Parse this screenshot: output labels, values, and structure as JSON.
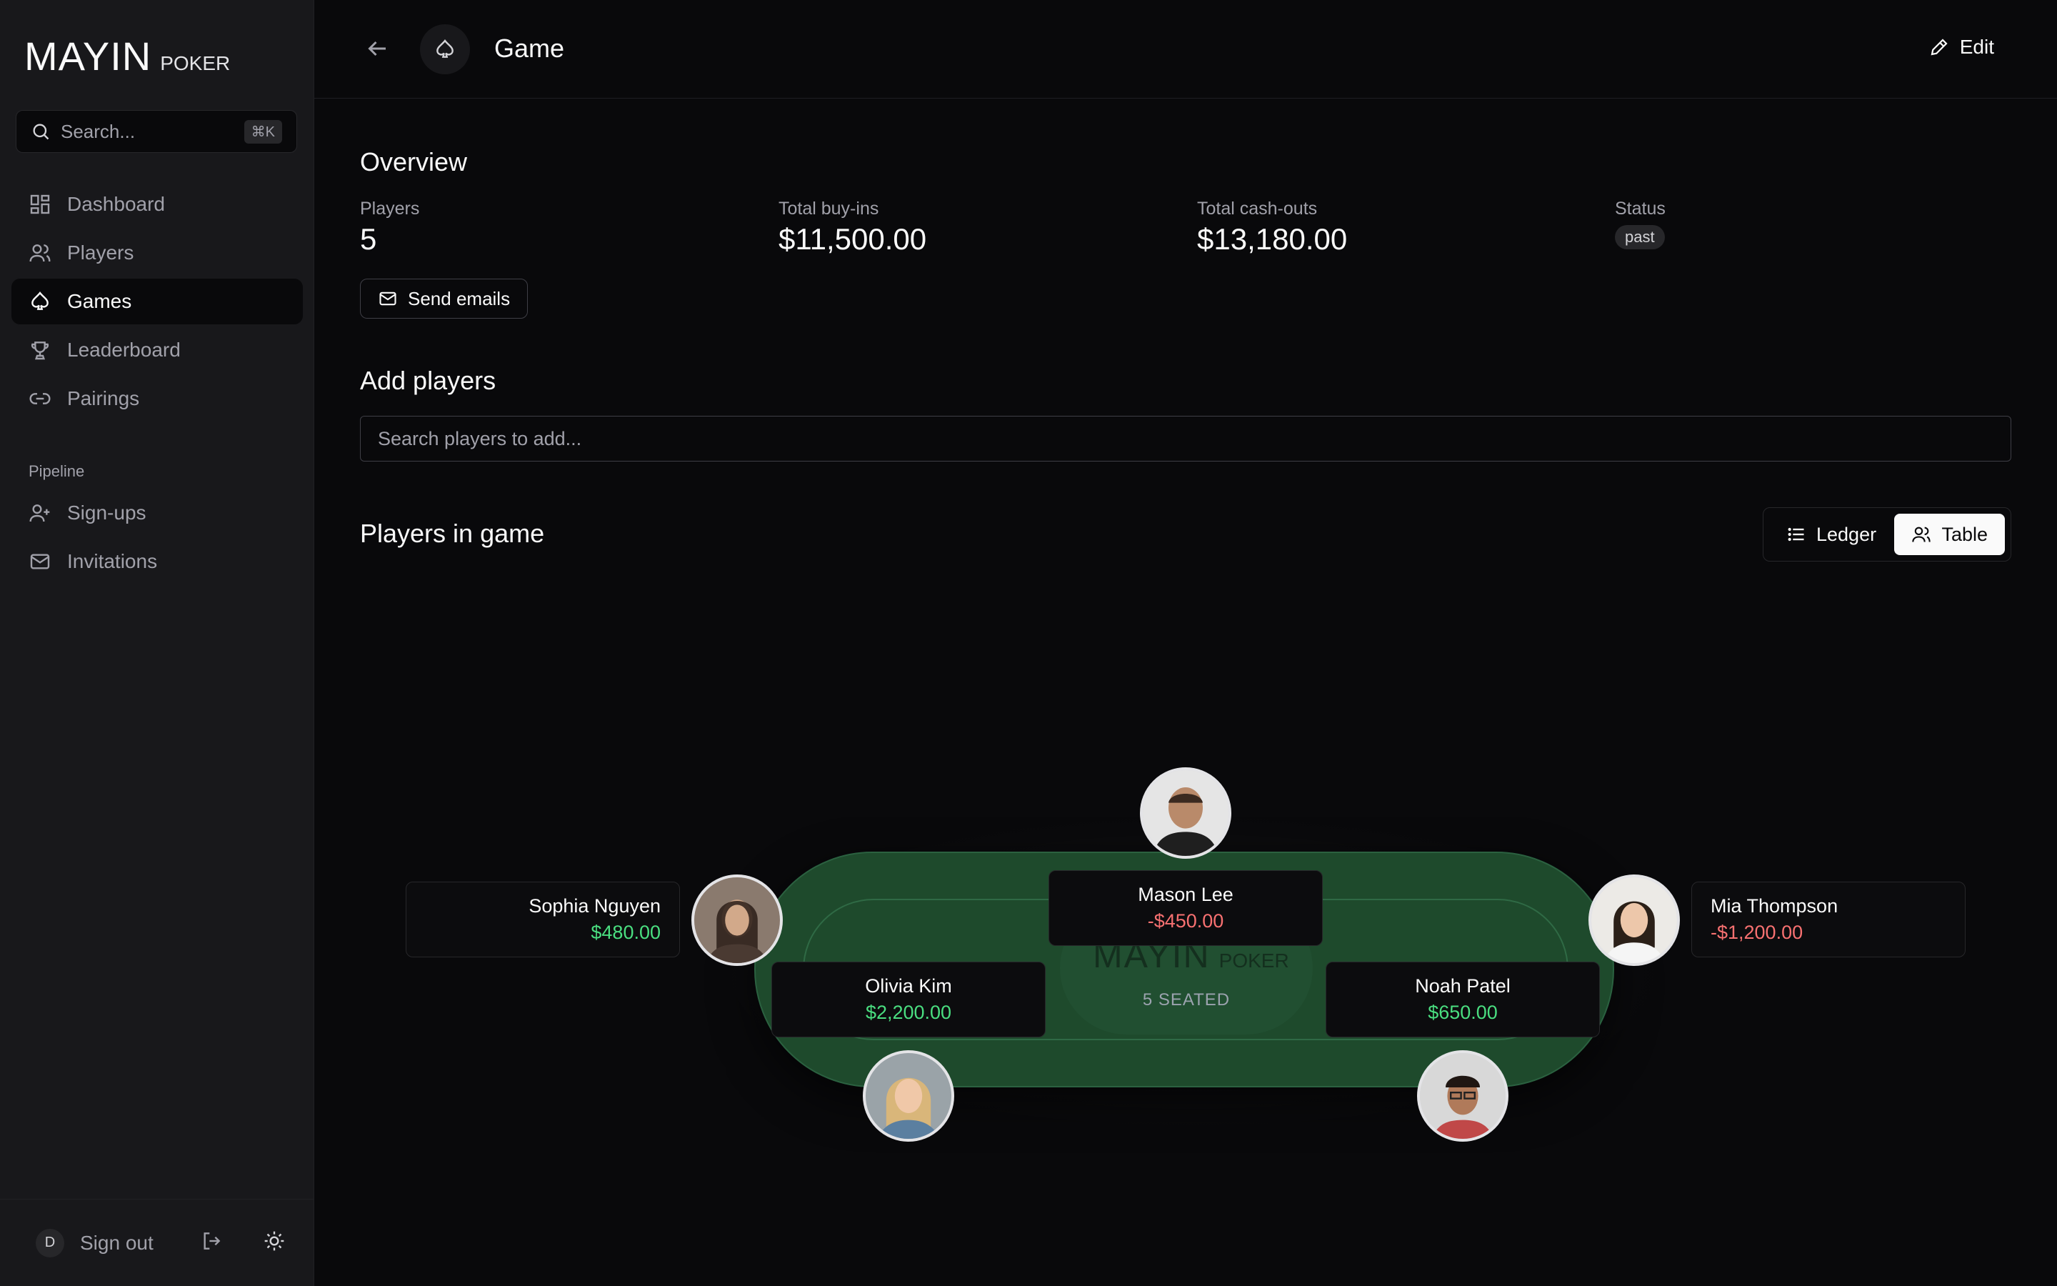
{
  "brand": {
    "name": "MAYIN",
    "sub": "POKER"
  },
  "search": {
    "placeholder": "Search...",
    "shortcut": "⌘K"
  },
  "nav": {
    "items": [
      {
        "label": "Dashboard",
        "icon": "dashboard-icon"
      },
      {
        "label": "Players",
        "icon": "users-icon"
      },
      {
        "label": "Games",
        "icon": "spade-icon",
        "active": true
      },
      {
        "label": "Leaderboard",
        "icon": "trophy-icon"
      },
      {
        "label": "Pairings",
        "icon": "link-icon"
      }
    ],
    "section_label": "Pipeline",
    "pipeline": [
      {
        "label": "Sign-ups",
        "icon": "user-plus-icon"
      },
      {
        "label": "Invitations",
        "icon": "mail-icon"
      }
    ]
  },
  "footer": {
    "avatar_initial": "D",
    "signout_label": "Sign out"
  },
  "header": {
    "title": "Game",
    "edit_label": "Edit"
  },
  "overview": {
    "title": "Overview",
    "stats": {
      "players": {
        "label": "Players",
        "value": "5"
      },
      "buyins": {
        "label": "Total buy-ins",
        "value": "$11,500.00"
      },
      "cashouts": {
        "label": "Total cash-outs",
        "value": "$13,180.00"
      },
      "status": {
        "label": "Status",
        "value": "past"
      }
    },
    "send_emails_label": "Send emails"
  },
  "add_players": {
    "title": "Add players",
    "placeholder": "Search players to add..."
  },
  "players_in_game": {
    "title": "Players in game",
    "view_toggle": {
      "options": [
        "Ledger",
        "Table"
      ],
      "selected": "Table"
    },
    "table": {
      "logo_main": "MAYIN",
      "logo_sub": "POKER",
      "seated_label": "5 SEATED",
      "players": [
        {
          "name": "Mason Lee",
          "amount": "-$450.00",
          "sign": "negative"
        },
        {
          "name": "Sophia Nguyen",
          "amount": "$480.00",
          "sign": "positive"
        },
        {
          "name": "Mia Thompson",
          "amount": "-$1,200.00",
          "sign": "negative"
        },
        {
          "name": "Olivia Kim",
          "amount": "$2,200.00",
          "sign": "positive"
        },
        {
          "name": "Noah Patel",
          "amount": "$650.00",
          "sign": "positive"
        }
      ]
    }
  },
  "colors": {
    "positive": "#4ade80",
    "negative": "#f87171",
    "felt": "#1e4a2c",
    "background": "#09090b",
    "sidebar": "#18181b"
  }
}
